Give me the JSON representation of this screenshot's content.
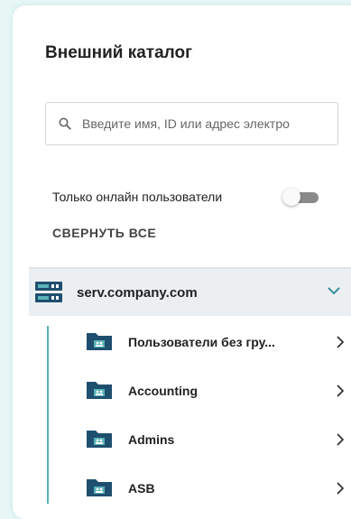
{
  "catalog": {
    "title": "Внешний каталог",
    "search_placeholder": "Введите имя, ID или адрес электро",
    "online_only_label": "Только онлайн пользователи",
    "online_only_enabled": false,
    "collapse_all_label": "СВЕРНУТЬ ВСЕ",
    "server": {
      "name": "serv.company.com",
      "expanded": true
    },
    "groups": [
      {
        "label": "Пользователи без гру..."
      },
      {
        "label": "Accounting"
      },
      {
        "label": "Admins"
      },
      {
        "label": "ASB"
      }
    ]
  },
  "colors": {
    "accent": "#3a8fa0",
    "folder": "#1f4f6e",
    "tree_line": "#5ab3b8",
    "background": "#e6f7f6"
  }
}
